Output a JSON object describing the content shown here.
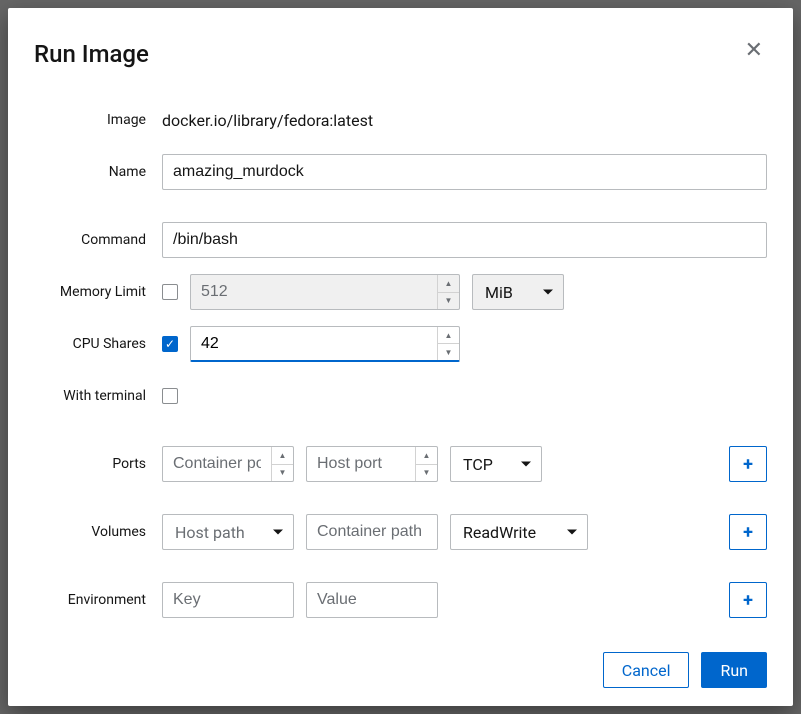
{
  "dialog": {
    "title": "Run Image"
  },
  "labels": {
    "image": "Image",
    "name": "Name",
    "command": "Command",
    "memory_limit": "Memory Limit",
    "cpu_shares": "CPU Shares",
    "with_terminal": "With terminal",
    "ports": "Ports",
    "volumes": "Volumes",
    "environment": "Environment"
  },
  "values": {
    "image": "docker.io/library/fedora:latest",
    "name": "amazing_murdock",
    "command": "/bin/bash",
    "memory_limit": "512",
    "memory_unit": "MiB",
    "cpu_shares": "42",
    "memory_enabled": false,
    "cpu_enabled": true,
    "with_terminal": false
  },
  "placeholders": {
    "container_port": "Container port",
    "host_port": "Host port",
    "host_path": "Host path",
    "container_path": "Container path",
    "env_key": "Key",
    "env_value": "Value"
  },
  "selects": {
    "protocol": "TCP",
    "volume_mode": "ReadWrite"
  },
  "buttons": {
    "cancel": "Cancel",
    "run": "Run"
  }
}
